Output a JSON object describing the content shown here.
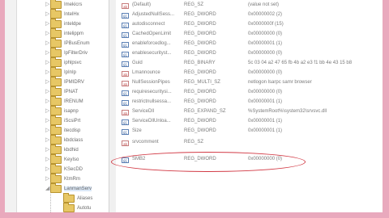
{
  "tree": {
    "items": [
      {
        "label": "Imekicrs"
      },
      {
        "label": "IntelHx"
      },
      {
        "label": "inteldpe"
      },
      {
        "label": "intelippm"
      },
      {
        "label": "IPBusEnum"
      },
      {
        "label": "IpFilterDriv"
      },
      {
        "label": "iphlpsvc"
      },
      {
        "label": "IpInIp"
      },
      {
        "label": "IPMIDRV"
      },
      {
        "label": "IPNAT"
      },
      {
        "label": "IRENUM"
      },
      {
        "label": "isapnp"
      },
      {
        "label": "iScsiPrt"
      },
      {
        "label": "itecdisp"
      },
      {
        "label": "kbdclass"
      },
      {
        "label": "kbdhid"
      },
      {
        "label": "KeyIso"
      },
      {
        "label": "KSecDD"
      },
      {
        "label": "KtmRm"
      },
      {
        "label": "LanmanServ"
      }
    ],
    "children": [
      {
        "label": "Aliases"
      },
      {
        "label": "Autotu"
      }
    ]
  },
  "values": {
    "rows": [
      {
        "icon": "ab",
        "name": "(Default)",
        "type": "REG_SZ",
        "data": "(value not set)"
      },
      {
        "icon": "01",
        "name": "AdjustedNullSess...",
        "type": "REG_DWORD",
        "data": "0x00000002 (2)"
      },
      {
        "icon": "01",
        "name": "autodisconnect",
        "type": "REG_DWORD",
        "data": "0x0000000f (15)"
      },
      {
        "icon": "01",
        "name": "CachedOpenLimit",
        "type": "REG_DWORD",
        "data": "0x00000000 (0)"
      },
      {
        "icon": "01",
        "name": "enableforcedlog...",
        "type": "REG_DWORD",
        "data": "0x00000001 (1)"
      },
      {
        "icon": "01",
        "name": "enablesecurityst...",
        "type": "REG_DWORD",
        "data": "0x00000000 (0)"
      },
      {
        "icon": "01",
        "name": "Guid",
        "type": "REG_BINARY",
        "data": "5c 03 04 a2 47 65 fb 4b a2 e3 f1 bb 4e 43 15 b8"
      },
      {
        "icon": "ab",
        "name": "Lmannounce",
        "type": "REG_DWORD",
        "data": "0x00000000 (0)"
      },
      {
        "icon": "ab",
        "name": "NullSessionPipes",
        "type": "REG_MULTI_SZ",
        "data": "netlogon lsarpc samr browser"
      },
      {
        "icon": "01",
        "name": "requiresecuritysi...",
        "type": "REG_DWORD",
        "data": "0x00000000 (0)"
      },
      {
        "icon": "01",
        "name": "restrictnullsessa...",
        "type": "REG_DWORD",
        "data": "0x00000001 (1)"
      },
      {
        "icon": "ab",
        "name": "ServiceDll",
        "type": "REG_EXPAND_SZ",
        "data": "%SystemRoot%\\system32\\srvsvc.dll"
      },
      {
        "icon": "01",
        "name": "ServiceDllUnloa...",
        "type": "REG_DWORD",
        "data": "0x00000001 (1)"
      },
      {
        "icon": "01",
        "name": "Size",
        "type": "REG_DWORD",
        "data": "0x00000001 (1)"
      },
      {
        "icon": "ab",
        "name": "srvcomment",
        "type": "REG_SZ",
        "data": ""
      },
      {
        "icon": "01",
        "name": "SMB2",
        "type": "REG_DWORD",
        "data": "0x00000000 (0)"
      }
    ]
  },
  "colors": {
    "frame": "#e9a9bd",
    "highlight_ellipse": "#d23a45"
  }
}
